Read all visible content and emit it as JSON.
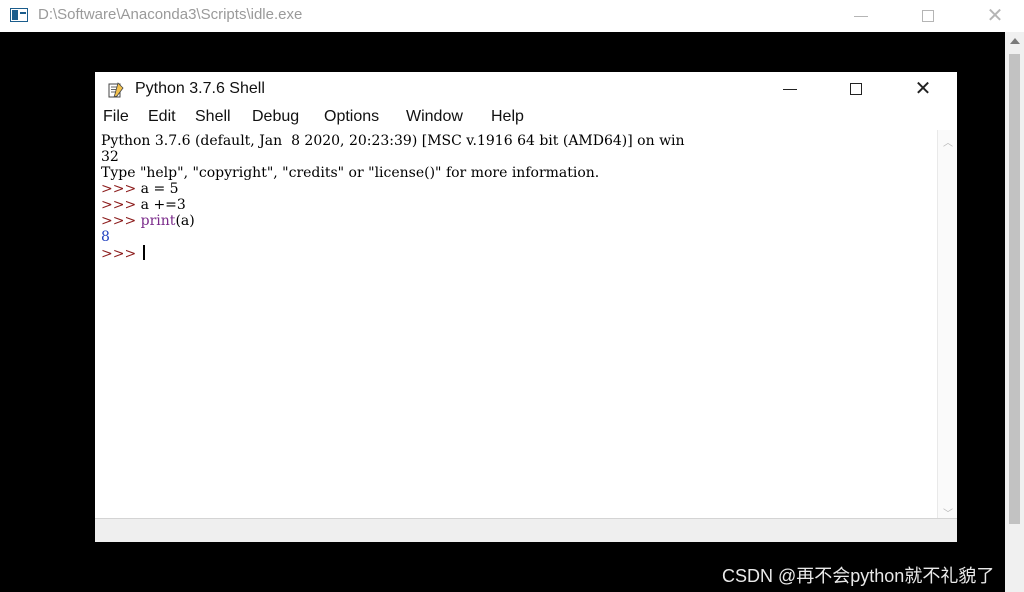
{
  "console_window": {
    "title": "D:\\Software\\Anaconda3\\Scripts\\idle.exe"
  },
  "idle_window": {
    "title": "Python 3.7.6 Shell",
    "menu": [
      "File",
      "Edit",
      "Shell",
      "Debug",
      "Options",
      "Window",
      "Help"
    ],
    "shell_lines": [
      "Python 3.7.6 (default, Jan  8 2020, 20:23:39) [MSC v.1916 64 bit (AMD64)] on win",
      "32",
      "Type \"help\", \"copyright\", \"credits\" or \"license()\" for more information.",
      ">>> a = 5",
      ">>> a +=3",
      ">>> print(a)",
      "8",
      ">>> "
    ],
    "prompt": ">>>",
    "cmd_1": " a = 5",
    "cmd_2": " a +=3",
    "cmd_3_func": "print",
    "cmd_3_args": "(a)",
    "output": "8"
  },
  "icons": {
    "console": "console-app-icon",
    "idle": "python-idle-icon",
    "minimize": "minimize-icon",
    "maximize": "maximize-icon",
    "close": "close-icon"
  },
  "colors": {
    "prompt": "#8b1a1a",
    "builtin": "#7a2a8a",
    "output": "#1f3fbf"
  },
  "watermark": "CSDN @再不会python就不礼貌了"
}
